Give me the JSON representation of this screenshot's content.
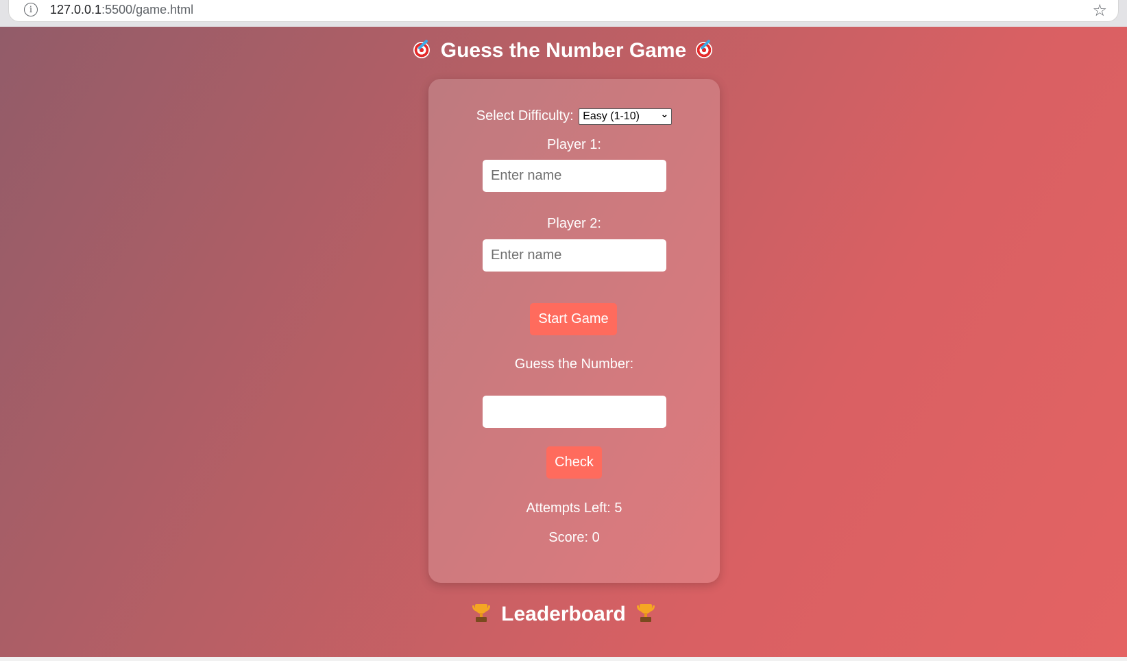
{
  "browser": {
    "url_host": "127.0.0.1",
    "url_rest": ":5500/game.html"
  },
  "page": {
    "title": "Guess the Number Game",
    "title_icon": "direct-hit-icon",
    "difficulty_label": "Select Difficulty:",
    "difficulty_selected": "Easy (1-10)",
    "player1_label": "Player 1:",
    "player1_placeholder": "Enter name",
    "player1_value": "",
    "player2_label": "Player 2:",
    "player2_placeholder": "Enter name",
    "player2_value": "",
    "start_button": "Start Game",
    "guess_label": "Guess the Number:",
    "guess_value": "",
    "check_button": "Check",
    "attempts_text": "Attempts Left: 5",
    "score_text": "Score: 0",
    "leaderboard_title": "Leaderboard",
    "leaderboard_icon": "trophy-icon"
  },
  "colors": {
    "button": "#ff6b5d",
    "background_start": "#925c69",
    "background_end": "#e46363"
  }
}
